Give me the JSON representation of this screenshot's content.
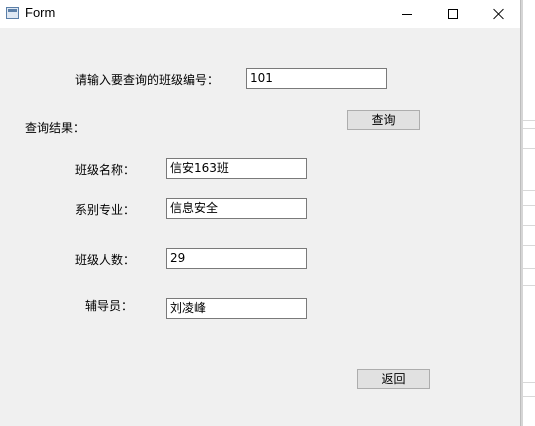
{
  "window": {
    "title": "Form"
  },
  "query": {
    "prompt_label": "请输入要查询的班级编号：",
    "class_id_value": "101",
    "search_button": "查询"
  },
  "results": {
    "heading": "查询结果：",
    "class_name_label": "班级名称：",
    "class_name_value": "信安163班",
    "major_label": "系别专业：",
    "major_value": "信息安全",
    "count_label": "班级人数：",
    "count_value": "29",
    "advisor_label": "辅导员：",
    "advisor_value": "刘凌峰"
  },
  "footer": {
    "back_button": "返回"
  },
  "icons": {
    "app": "form-window-icon",
    "minimize": "minimize-icon",
    "maximize": "maximize-icon",
    "close": "close-icon"
  }
}
